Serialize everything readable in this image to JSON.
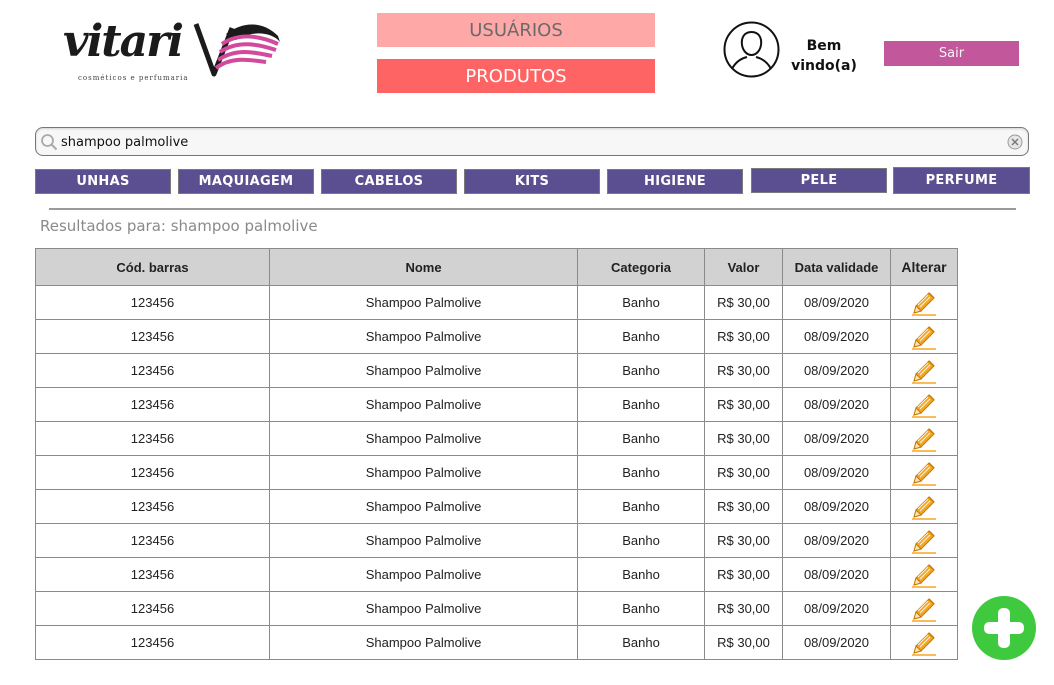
{
  "brand": {
    "name": "vitari",
    "tagline": "cosméticos e perfumaria"
  },
  "nav": {
    "users_label": "USUÁRIOS",
    "products_label": "PRODUTOS"
  },
  "user": {
    "welcome_line1": "Bem",
    "welcome_line2": "vindo(a)",
    "logout_label": "Sair"
  },
  "search": {
    "value": "shampoo palmolive",
    "placeholder": ""
  },
  "categories": [
    {
      "label": "UNHAS"
    },
    {
      "label": "MAQUIAGEM"
    },
    {
      "label": "CABELOS"
    },
    {
      "label": "KITS"
    },
    {
      "label": "HIGIENE"
    },
    {
      "label": "PELE"
    },
    {
      "label": "PERFUME"
    }
  ],
  "results_label": "Resultados para: shampoo palmolive",
  "table": {
    "headers": [
      "Cód. barras",
      "Nome",
      "Categoria",
      "Valor",
      "Data validade",
      "Alterar"
    ],
    "rows": [
      [
        "123456",
        "Shampoo Palmolive",
        "Banho",
        "R$ 30,00",
        "08/09/2020"
      ],
      [
        "123456",
        "Shampoo Palmolive",
        "Banho",
        "R$ 30,00",
        "08/09/2020"
      ],
      [
        "123456",
        "Shampoo Palmolive",
        "Banho",
        "R$ 30,00",
        "08/09/2020"
      ],
      [
        "123456",
        "Shampoo Palmolive",
        "Banho",
        "R$ 30,00",
        "08/09/2020"
      ],
      [
        "123456",
        "Shampoo Palmolive",
        "Banho",
        "R$ 30,00",
        "08/09/2020"
      ],
      [
        "123456",
        "Shampoo Palmolive",
        "Banho",
        "R$ 30,00",
        "08/09/2020"
      ],
      [
        "123456",
        "Shampoo Palmolive",
        "Banho",
        "R$ 30,00",
        "08/09/2020"
      ],
      [
        "123456",
        "Shampoo Palmolive",
        "Banho",
        "R$ 30,00",
        "08/09/2020"
      ],
      [
        "123456",
        "Shampoo Palmolive",
        "Banho",
        "R$ 30,00",
        "08/09/2020"
      ],
      [
        "123456",
        "Shampoo Palmolive",
        "Banho",
        "R$ 30,00",
        "08/09/2020"
      ],
      [
        "123456",
        "Shampoo Palmolive",
        "Banho",
        "R$ 30,00",
        "08/09/2020"
      ]
    ]
  },
  "icons": {
    "logo": "vitari-logo",
    "avatar": "user-avatar-icon",
    "search": "search-icon",
    "clear": "clear-icon",
    "edit": "pencil-icon",
    "add": "plus-circle-icon"
  },
  "colors": {
    "nav_users": "#ffa8a8",
    "nav_products": "#ff6464",
    "logout": "#c2579b",
    "category": "#5b4f91",
    "edit_icon": "#f5a623",
    "add_button": "#3ec93e",
    "alter_header": "#f59a1e"
  }
}
